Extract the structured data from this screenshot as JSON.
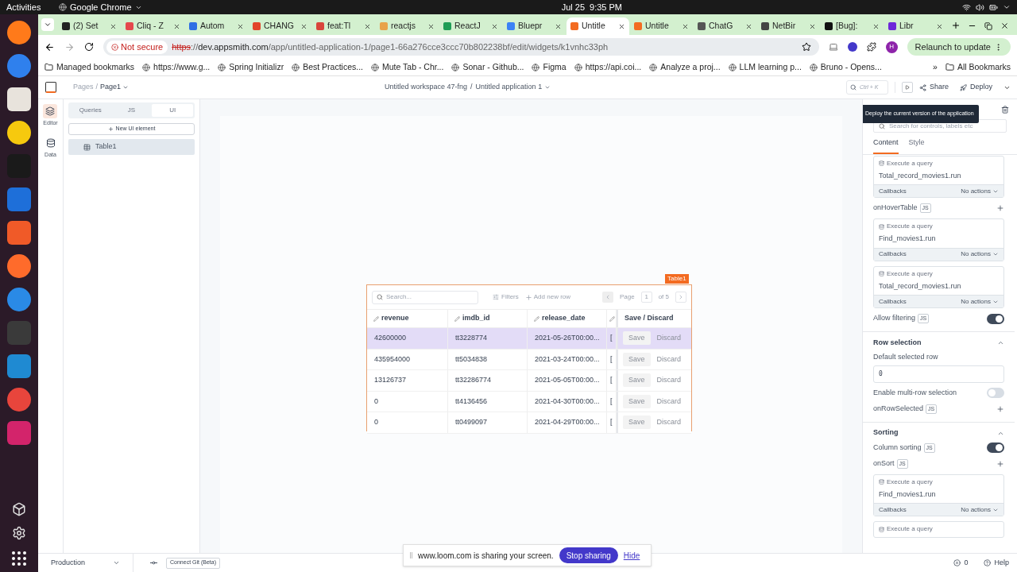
{
  "os_bar": {
    "activities": "Activities",
    "app": "Google Chrome",
    "date": "Jul 25",
    "time": "9:35 PM"
  },
  "browser": {
    "tabs": [
      {
        "title": "(2) Set",
        "selected": false,
        "color": "#222222"
      },
      {
        "title": "Cliq - Z",
        "selected": false,
        "color": "#e5484d"
      },
      {
        "title": "Autom",
        "selected": false,
        "color": "#2f6fe4"
      },
      {
        "title": "CHANG",
        "selected": false,
        "color": "#e24329"
      },
      {
        "title": "feat:Tl",
        "selected": false,
        "color": "#d9453b"
      },
      {
        "title": "reactjs",
        "selected": false,
        "color": "#e8a24a"
      },
      {
        "title": "ReactJ",
        "selected": false,
        "color": "#1f9d55"
      },
      {
        "title": "Bluepr",
        "selected": false,
        "color": "#3b82f6"
      },
      {
        "title": "Untitle",
        "selected": true,
        "color": "#f36b21"
      },
      {
        "title": "Untitle",
        "selected": false,
        "color": "#f36b21"
      },
      {
        "title": "ChatG",
        "selected": false,
        "color": "#555555"
      },
      {
        "title": "NetBir",
        "selected": false,
        "color": "#444444"
      },
      {
        "title": "[Bug]:",
        "selected": false,
        "color": "#111111"
      },
      {
        "title": "Libr",
        "selected": false,
        "color": "#6d28d9"
      }
    ],
    "not_secure": "Not secure",
    "url_scheme": "https",
    "url_separator": "://",
    "url_host": "dev.appsmith.com",
    "url_path": "/app/untitled-application-1/page1-66a276cce3ccc70b802238bf/edit/widgets/k1vnhc33ph",
    "avatar": "H",
    "relaunch": "Relaunch to update",
    "bookmarks": [
      "Managed bookmarks",
      "https://www.g...",
      "Spring Initializr",
      "Best Practices...",
      "Mute Tab - Chr...",
      "Sonar - Github...",
      "Figma",
      "https://api.coi...",
      "Analyze a proj...",
      "LLM learning p...",
      "Bruno - Opens..."
    ],
    "more": "»",
    "all_bookmarks": "All Bookmarks"
  },
  "header": {
    "pages": "Pages",
    "pages_separator": "/",
    "page": "Page1",
    "workspace_separator": "/",
    "workspace": "Untitled workspace 47-fng",
    "application": "Untitled application 1",
    "search_hint": "Ctrl + K",
    "share": "Share",
    "deploy": "Deploy"
  },
  "rail": [
    {
      "label": "Editor",
      "selected": true
    },
    {
      "label": "Data",
      "selected": false
    }
  ],
  "explorer": {
    "segments": [
      {
        "label": "Queries",
        "selected": false
      },
      {
        "label": "JS",
        "selected": false
      },
      {
        "label": "UI",
        "selected": true
      }
    ],
    "new_button": "New UI element",
    "items": [
      {
        "label": "Table1",
        "selected": true
      }
    ]
  },
  "table": {
    "name": "Table1",
    "search_placeholder": "Search...",
    "filters": "Filters",
    "add_row": "Add new row",
    "page_label": "Page",
    "page": "1",
    "page_total": "of 5",
    "columns": [
      "revenue",
      "imdb_id",
      "release_date",
      ""
    ],
    "actions_header": "Save / Discard",
    "rows": [
      {
        "cells": [
          "42600000",
          "tt3228774",
          "2021-05-26T00:00...",
          "["
        ],
        "selected": true,
        "save": "Save",
        "discard": "Discard"
      },
      {
        "cells": [
          "435954000",
          "tt5034838",
          "2021-03-24T00:00...",
          "["
        ],
        "selected": false,
        "save": "Save",
        "discard": "Discard"
      },
      {
        "cells": [
          "13126737",
          "tt32286774",
          "2021-05-05T00:00...",
          "["
        ],
        "selected": false,
        "save": "Save",
        "discard": "Discard"
      },
      {
        "cells": [
          "0",
          "tt4136456",
          "2021-04-30T00:00...",
          "["
        ],
        "selected": false,
        "save": "Save",
        "discard": "Discard"
      },
      {
        "cells": [
          "0",
          "tt0499097",
          "2021-04-29T00:00...",
          "["
        ],
        "selected": false,
        "save": "Save",
        "discard": "Discard"
      }
    ]
  },
  "property_pane": {
    "tooltip": "Deploy the current version of the application",
    "search_placeholder": "Search for controls, labels etc",
    "tabs": [
      {
        "label": "Content",
        "selected": true
      },
      {
        "label": "Style",
        "selected": false
      }
    ],
    "items": [
      {
        "kind": "action",
        "title": "Execute a query",
        "value": "Total_record_movies1.run",
        "callbacks": "Callbacks",
        "actions": "No actions"
      },
      {
        "kind": "event",
        "label": "onHoverTable",
        "badge": "JS"
      },
      {
        "kind": "action",
        "title": "Execute a query",
        "value": "Find_movies1.run",
        "callbacks": "Callbacks",
        "actions": "No actions"
      },
      {
        "kind": "action",
        "title": "Execute a query",
        "value": "Total_record_movies1.run",
        "callbacks": "Callbacks",
        "actions": "No actions"
      },
      {
        "kind": "toggle",
        "label": "Allow filtering",
        "badge": "JS",
        "on": true
      },
      {
        "kind": "section",
        "label": "Row selection",
        "expanded": true
      },
      {
        "kind": "input",
        "label": "Default selected row",
        "value": "0"
      },
      {
        "kind": "toggle",
        "label": "Enable multi-row selection",
        "on": false
      },
      {
        "kind": "event",
        "label": "onRowSelected",
        "badge": "JS"
      },
      {
        "kind": "section",
        "label": "Sorting",
        "expanded": true
      },
      {
        "kind": "toggle",
        "label": "Column sorting",
        "badge": "JS",
        "on": true
      },
      {
        "kind": "event",
        "label": "onSort",
        "badge": "JS"
      },
      {
        "kind": "action",
        "title": "Execute a query",
        "value": "Find_movies1.run",
        "callbacks": "Callbacks",
        "actions": "No actions"
      },
      {
        "kind": "action_head",
        "title": "Execute a query"
      }
    ]
  },
  "bottom_bar": {
    "environment": "Production",
    "git": "Connect Git (Beta)",
    "errors": "0",
    "help": "Help"
  },
  "share_banner": {
    "message": "www.loom.com is sharing your screen.",
    "stop": "Stop sharing",
    "hide": "Hide"
  }
}
